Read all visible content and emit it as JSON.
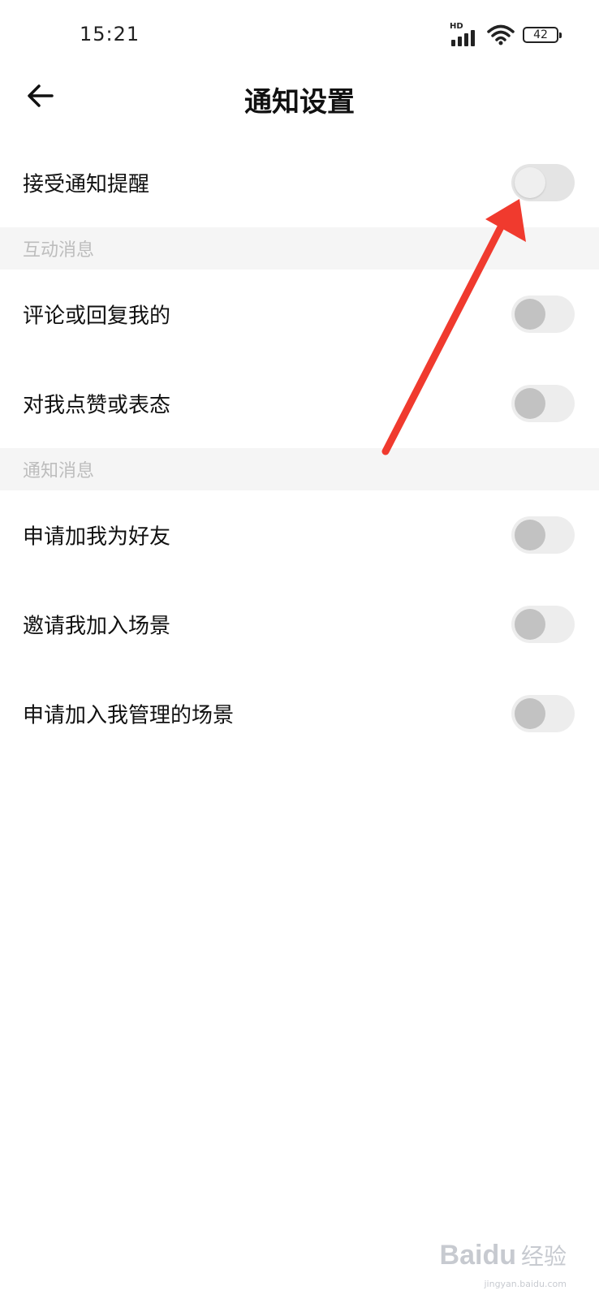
{
  "status_bar": {
    "time": "15:21",
    "network": "HD",
    "battery": "42"
  },
  "header": {
    "back_icon": "arrow-left-icon",
    "title": "通知设置"
  },
  "main_toggle": {
    "label": "接受通知提醒",
    "on": false
  },
  "sections": [
    {
      "title": "互动消息",
      "items": [
        {
          "label": "评论或回复我的",
          "on": false
        },
        {
          "label": "对我点赞或表态",
          "on": false
        }
      ]
    },
    {
      "title": "通知消息",
      "items": [
        {
          "label": "申请加我为好友",
          "on": false
        },
        {
          "label": "邀请我加入场景",
          "on": false
        },
        {
          "label": "申请加入我管理的场景",
          "on": false
        }
      ]
    }
  ],
  "watermark": {
    "brand": "Baidu",
    "brand_cn": "经验",
    "url": "jingyan.baidu.com"
  },
  "colors": {
    "annotation_arrow": "#f03a2e",
    "section_bg": "#f5f5f5",
    "section_text": "#bdbdbd",
    "toggle_track": "#ededed",
    "toggle_knob": "#c2c2c2"
  }
}
